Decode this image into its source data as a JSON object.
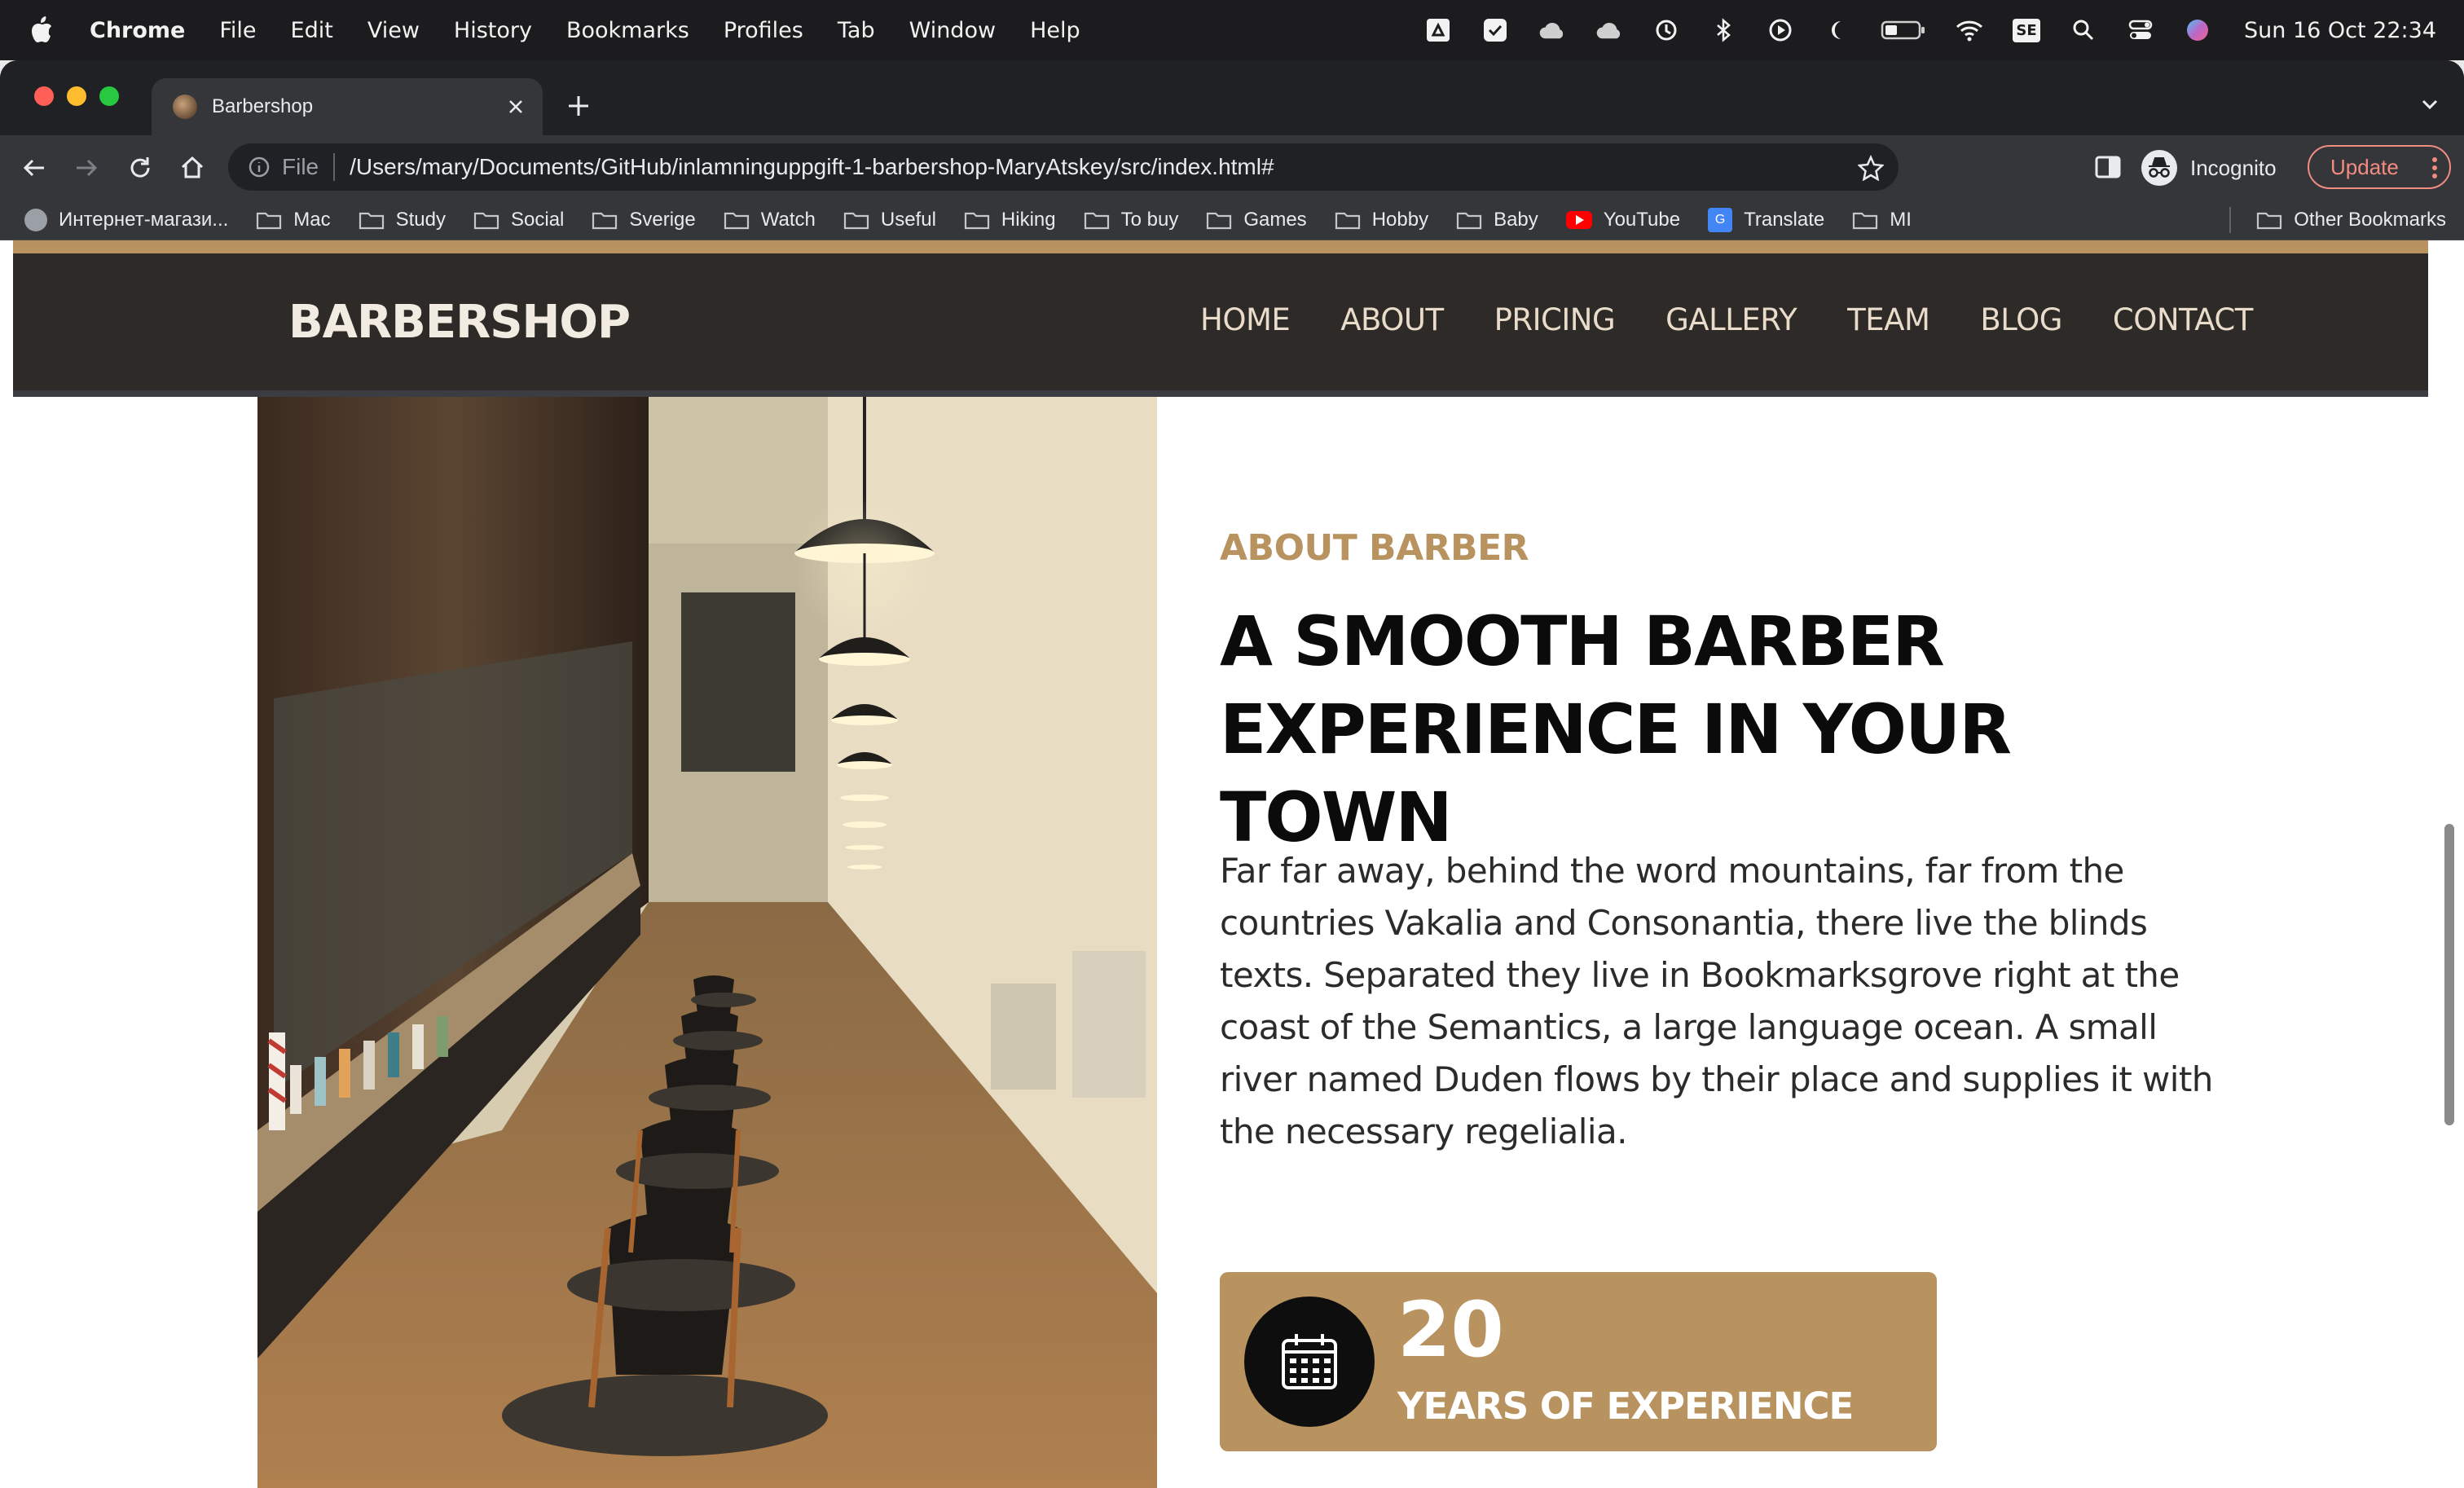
{
  "menubar": {
    "app_name": "Chrome",
    "items": [
      "File",
      "Edit",
      "View",
      "History",
      "Bookmarks",
      "Profiles",
      "Tab",
      "Window",
      "Help"
    ],
    "clock": "Sun 16 Oct  22:34",
    "tray_icons": [
      "drive-icon",
      "tasks-icon",
      "cloud-icon",
      "cloud-icon",
      "time-machine-icon",
      "bluetooth-icon",
      "play-icon",
      "moon-icon",
      "battery-icon",
      "wifi-icon",
      "keyboard-layout-icon",
      "search-icon",
      "control-center-icon",
      "siri-icon"
    ],
    "keyboard_layout": "SE"
  },
  "browser": {
    "tab_title": "Barbershop",
    "address_scheme": "File",
    "url": "/Users/mary/Documents/GitHub/inlamninguppgift-1-barbershop-MaryAtskey/src/index.html#",
    "incognito_label": "Incognito",
    "update_label": "Update",
    "bookmarks": [
      {
        "label": "Интернет-магази...",
        "icon": "globe-icon"
      },
      {
        "label": "Mac",
        "icon": "folder-icon"
      },
      {
        "label": "Study",
        "icon": "folder-icon"
      },
      {
        "label": "Social",
        "icon": "folder-icon"
      },
      {
        "label": "Sverige",
        "icon": "folder-icon"
      },
      {
        "label": "Watch",
        "icon": "folder-icon"
      },
      {
        "label": "Useful",
        "icon": "folder-icon"
      },
      {
        "label": "Hiking",
        "icon": "folder-icon"
      },
      {
        "label": "To buy",
        "icon": "folder-icon"
      },
      {
        "label": "Games",
        "icon": "folder-icon"
      },
      {
        "label": "Hobby",
        "icon": "folder-icon"
      },
      {
        "label": "Baby",
        "icon": "folder-icon"
      },
      {
        "label": "YouTube",
        "icon": "youtube-icon"
      },
      {
        "label": "Translate",
        "icon": "translate-icon"
      },
      {
        "label": "MI",
        "icon": "folder-icon"
      }
    ],
    "other_bookmarks": "Other Bookmarks"
  },
  "site": {
    "logo": "BARBERSHOP",
    "nav": [
      "HOME",
      "ABOUT",
      "PRICING",
      "GALLERY",
      "TEAM",
      "BLOG",
      "CONTACT"
    ],
    "about_label": "ABOUT BARBER",
    "about_title": "A SMOOTH BARBER EXPERIENCE IN YOUR TOWN",
    "about_text": "Far far away, behind the word mountains, far from the countries Vakalia and Consonantia, there live the blinds texts. Separated they live in Bookmarksgrove right at the coast of the Semantics, a large language ocean. A small river named Duden flows by their place and supplies it with the necessary regelialia.",
    "experience_number": "20",
    "experience_label": "YEARS OF EXPERIENCE"
  },
  "colors": {
    "accent": "#b8925f",
    "header_bg": "#2d2a27",
    "nav_text": "#e9dccb"
  }
}
